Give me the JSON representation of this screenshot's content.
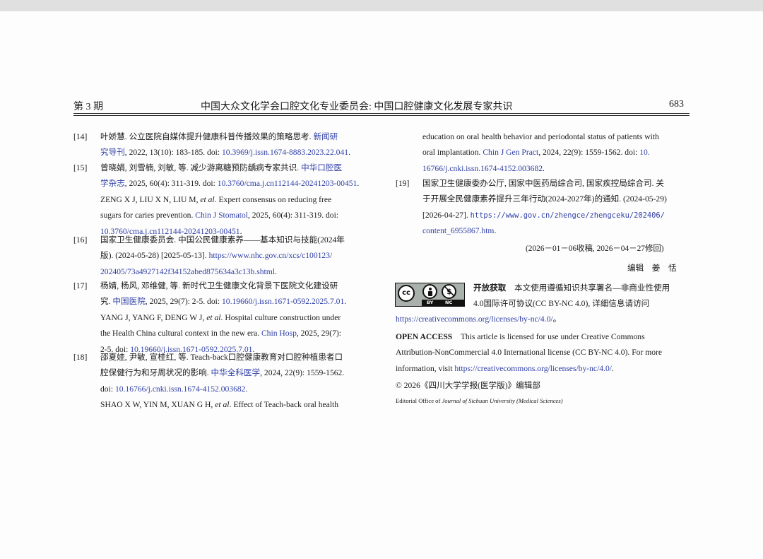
{
  "header": {
    "issue": "第 3 期",
    "title": "中国大众文化学会口腔文化专业委员会: 中国口腔健康文化发展专家共识",
    "page": "683"
  },
  "refs": [
    {
      "num": "[14]",
      "lines": [
        [
          {
            "t": "叶娇慧. 公立医院自媒体提升健康科普传播效果的策略思考. "
          },
          {
            "t": "新闻研",
            "b": 1
          }
        ],
        [
          {
            "t": "究导刊",
            "b": 1
          },
          {
            "t": ", 2022, 13(10): 183-185. doi: "
          },
          {
            "t": "10.3969/j.issn.1674-8883.2023.22.041",
            "b": 1
          },
          {
            "t": "."
          }
        ]
      ]
    },
    {
      "num": "[15]",
      "lines": [
        [
          {
            "t": "曾晓娟, 刘雪楠, 刘敏, 等. 减少游离糖预防龋病专家共识. "
          },
          {
            "t": "中华口腔医",
            "b": 1
          }
        ],
        [
          {
            "t": "学杂志",
            "b": 1
          },
          {
            "t": ", 2025, 60(4): 311-319. doi: "
          },
          {
            "t": "10.3760/cma.j.cn112144-20241203-00451",
            "b": 1
          },
          {
            "t": "."
          }
        ],
        [
          {
            "t": "ZENG X J, LIU X N, LIU M, "
          },
          {
            "t": "et al",
            "i": 1
          },
          {
            "t": ". Expert consensus on reducing free"
          }
        ],
        [
          {
            "t": "sugars for caries prevention. "
          },
          {
            "t": "Chin J Stomatol",
            "b": 1
          },
          {
            "t": ", 2025, 60(4): 311-319. doi:"
          }
        ],
        [
          {
            "t": "10.3760/cma.j.cn112144-20241203-00451",
            "b": 1
          },
          {
            "t": "."
          }
        ]
      ]
    },
    {
      "num": "[16]",
      "lines": [
        [
          {
            "t": "国家卫生健康委员会. 中国公民健康素养——基本知识与技能(2024年"
          }
        ],
        [
          {
            "t": "版). (2024-05-28) [2025-05-13]. "
          },
          {
            "t": "https://www.nhc.gov.cn/xcs/c100123/",
            "b": 1
          }
        ],
        [
          {
            "t": "202405/73a4927142f34152abed875634a3c13b.shtml",
            "b": 1
          },
          {
            "t": "."
          }
        ]
      ]
    },
    {
      "num": "[17]",
      "lines": [
        [
          {
            "t": "杨婧, 杨风, 邓维健, 等. 新时代卫生健康文化背景下医院文化建设研"
          }
        ],
        [
          {
            "t": "究. "
          },
          {
            "t": "中国医院",
            "b": 1
          },
          {
            "t": ", 2025, 29(7): 2-5. doi: "
          },
          {
            "t": "10.19660/j.issn.1671-0592.2025.7.01",
            "b": 1
          },
          {
            "t": "."
          }
        ],
        [
          {
            "t": "YANG J, YANG F, DENG W J, "
          },
          {
            "t": "et al",
            "i": 1
          },
          {
            "t": ". Hospital culture construction under"
          }
        ],
        [
          {
            "t": "the Health China cultural context in the new era. "
          },
          {
            "t": "Chin Hosp",
            "b": 1
          },
          {
            "t": ", 2025, 29(7):"
          }
        ],
        [
          {
            "t": "2-5. doi: "
          },
          {
            "t": "10.19660/j.issn.1671-0592.2025.7.01",
            "b": 1
          },
          {
            "t": "."
          }
        ]
      ]
    },
    {
      "num": "[18]",
      "lines": [
        [
          {
            "t": "邵夏娃, 尹敏, 宣桂红, 等. Teach-back口腔健康教育对口腔种植患者口"
          }
        ],
        [
          {
            "t": "腔保健行为和牙周状况的影响. "
          },
          {
            "t": "中华全科医学",
            "b": 1
          },
          {
            "t": ", 2024, 22(9): 1559-1562."
          }
        ],
        [
          {
            "t": "doi: "
          },
          {
            "t": "10.16766/j.cnki.issn.1674-4152.003682",
            "b": 1
          },
          {
            "t": "."
          }
        ],
        [
          {
            "t": "SHAO X W, YIN M, XUAN G H, "
          },
          {
            "t": "et al",
            "i": 1
          },
          {
            "t": ". Effect of Teach-back oral health"
          }
        ]
      ]
    }
  ],
  "right_cont": [
    [
      {
        "t": "education on oral health behavior and periodontal status of patients with"
      }
    ],
    [
      {
        "t": "oral implantation. "
      },
      {
        "t": "Chin J Gen Pract",
        "b": 1
      },
      {
        "t": ", 2024, 22(9): 1559-1562. doi: "
      },
      {
        "t": "10.",
        "b": 1
      }
    ],
    [
      {
        "t": "16766/j.cnki.issn.1674-4152.003682",
        "b": 1
      },
      {
        "t": "."
      }
    ]
  ],
  "ref19": {
    "num": "[19]",
    "lines": [
      [
        {
          "t": "国家卫生健康委办公厅, 国家中医药局综合司, 国家疾控局综合司. 关"
        }
      ],
      [
        {
          "t": "于开展全民健康素养提升三年行动(2024-2027年)的通知. (2024-05-29)"
        }
      ],
      [
        {
          "t": "[2026-04-27]. "
        },
        {
          "t": "https://www.gov.cn/zhengce/zhengceku/202406/",
          "b": 1,
          "m": 1
        }
      ],
      [
        {
          "t": "content_6955867.htm",
          "b": 1
        },
        {
          "t": "."
        }
      ]
    ]
  },
  "received": "(2026－01－06收稿, 2026－04－27修回)",
  "editor": "编辑　姜　恬",
  "cc_badge": {
    "by": "BY",
    "nc": "NC",
    "cc": "cc",
    "icon_by": "person-icon",
    "icon_nc": "no-dollar-icon"
  },
  "oa_cn": [
    [
      {
        "t": "开放获取",
        "s": 1
      },
      {
        "t": "　本文使用遵循知识共享署名—非商业性使用"
      }
    ],
    [
      {
        "t": "4.0国际许可协议(CC BY-NC 4.0), 详细信息请访问"
      }
    ]
  ],
  "oa_cn_url": [
    [
      {
        "t": "https://creativecommons.org/licenses/by-nc/4.0/",
        "b": 1
      },
      {
        "t": "。"
      }
    ]
  ],
  "oa_en": [
    [
      {
        "t": "OPEN ACCESS",
        "s": 1
      },
      {
        "t": "　This article is licensed for use under Creative Commons"
      }
    ],
    [
      {
        "t": "Attribution-NonCommercial 4.0 International license (CC BY-NC 4.0). For more"
      }
    ],
    [
      {
        "t": "information, visit "
      },
      {
        "t": "https://creativecommons.org/licenses/by-nc/4.0/",
        "b": 1
      },
      {
        "t": "."
      }
    ]
  ],
  "copyright": "© 2026《四川大学学报(医学版)》编辑部",
  "editorial_office": [
    {
      "t": "Editorial Office of "
    },
    {
      "t": "Journal of Sichuan University (Medical Sciences)",
      "i": 1
    }
  ],
  "colors": {
    "link": "#2f3fa6",
    "text": "#1a1a1a",
    "background": "#fdfdfd"
  }
}
